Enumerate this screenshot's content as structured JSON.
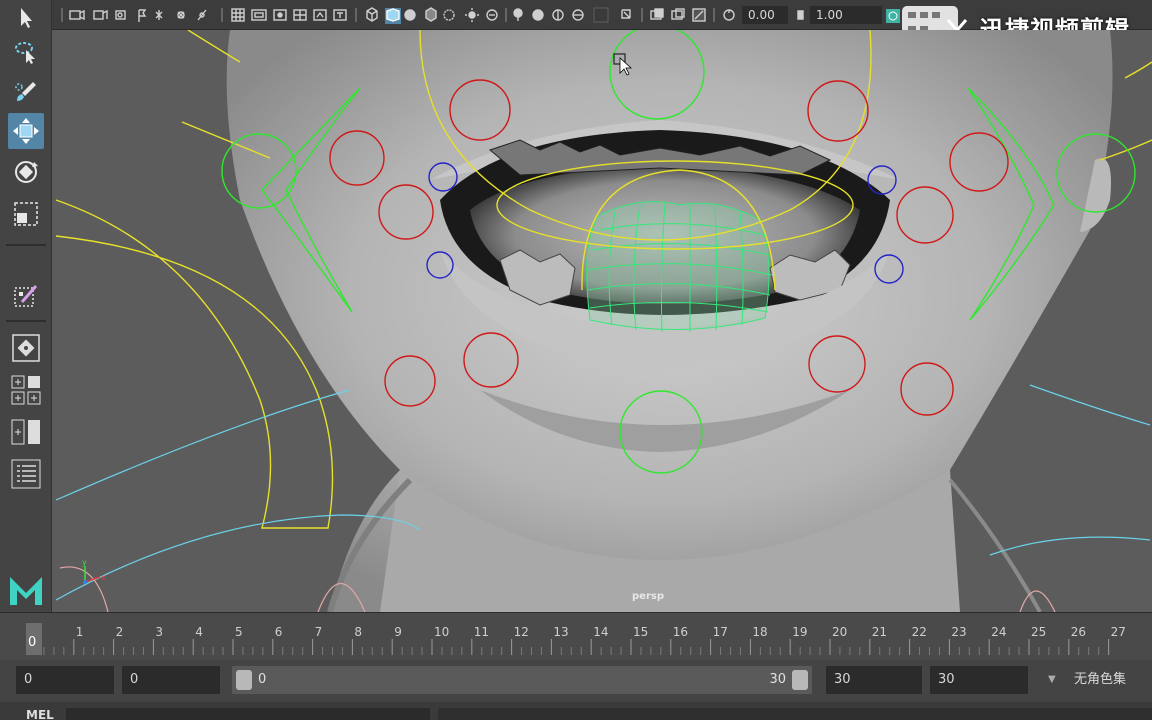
{
  "statusline": {
    "rotate_value": "0.00",
    "scale_value": "1.00"
  },
  "watermark": {
    "text": "迅捷视频剪辑"
  },
  "viewport": {
    "camera_label": "persp"
  },
  "timeslider": {
    "current_frame": "0",
    "frames": [
      "1",
      "2",
      "3",
      "4",
      "5",
      "6",
      "7",
      "8",
      "9",
      "10",
      "11",
      "12",
      "13",
      "14",
      "15",
      "16",
      "17",
      "18",
      "19",
      "20",
      "21",
      "22",
      "23",
      "24",
      "25",
      "26",
      "27"
    ]
  },
  "range": {
    "start_time": "0",
    "playback_start": "0",
    "slider_start": "0",
    "slider_end": "30",
    "playback_end": "30",
    "end_time": "30",
    "character_set": "无角色集"
  },
  "cmdline": {
    "label": "MEL"
  },
  "colors": {
    "ui_bg": "#444444",
    "active_tool": "#5285a6",
    "ctrl_red": "#d01818",
    "ctrl_green": "#2ee82e",
    "ctrl_yellow": "#e6e02a",
    "ctrl_blue": "#2424c8",
    "ctrl_cyan": "#6ad2e8"
  }
}
